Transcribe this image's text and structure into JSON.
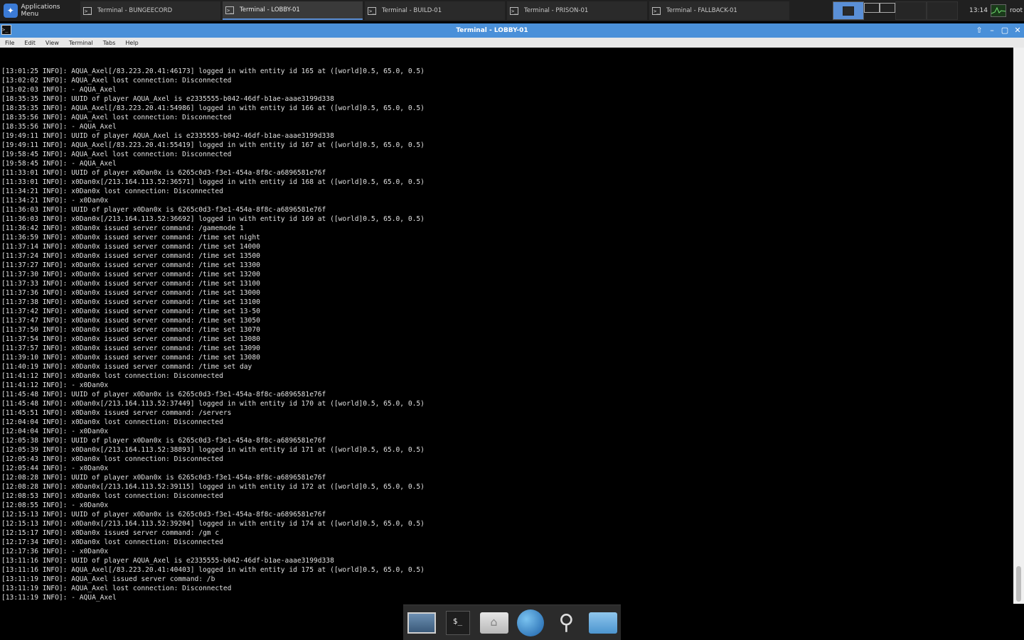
{
  "panel": {
    "apps_menu_label": "Applications Menu",
    "tasks": [
      {
        "label": "Terminal - BUNGEECORD",
        "active": false
      },
      {
        "label": "Terminal - LOBBY-01",
        "active": true
      },
      {
        "label": "Terminal - BUILD-01",
        "active": false
      },
      {
        "label": "Terminal - PRISON-01",
        "active": false
      },
      {
        "label": "Terminal - FALLBACK-01",
        "active": false
      }
    ],
    "clock": "13:14",
    "user": "root"
  },
  "window": {
    "title": "Terminal - LOBBY-01",
    "menu": [
      "File",
      "Edit",
      "View",
      "Terminal",
      "Tabs",
      "Help"
    ],
    "accent_color": "#4a90d9"
  },
  "terminal": {
    "lines": [
      "[13:01:25 INFO]: AQUA_Axel[/83.223.20.41:46173] logged in with entity id 165 at ([world]0.5, 65.0, 0.5)",
      "[13:02:02 INFO]: AQUA_Axel lost connection: Disconnected",
      "[13:02:03 INFO]: - AQUA_Axel",
      "[18:35:35 INFO]: UUID of player AQUA_Axel is e2335555-b042-46df-b1ae-aaae3199d338",
      "[18:35:35 INFO]: AQUA_Axel[/83.223.20.41:54986] logged in with entity id 166 at ([world]0.5, 65.0, 0.5)",
      "[18:35:56 INFO]: AQUA_Axel lost connection: Disconnected",
      "[18:35:56 INFO]: - AQUA_Axel",
      "[19:49:11 INFO]: UUID of player AQUA_Axel is e2335555-b042-46df-b1ae-aaae3199d338",
      "[19:49:11 INFO]: AQUA_Axel[/83.223.20.41:55419] logged in with entity id 167 at ([world]0.5, 65.0, 0.5)",
      "[19:58:45 INFO]: AQUA_Axel lost connection: Disconnected",
      "[19:58:45 INFO]: - AQUA_Axel",
      "[11:33:01 INFO]: UUID of player x0Dan0x is 6265c0d3-f3e1-454a-8f8c-a6896581e76f",
      "[11:33:01 INFO]: x0Dan0x[/213.164.113.52:36571] logged in with entity id 168 at ([world]0.5, 65.0, 0.5)",
      "[11:34:21 INFO]: x0Dan0x lost connection: Disconnected",
      "[11:34:21 INFO]: - x0Dan0x",
      "[11:36:03 INFO]: UUID of player x0Dan0x is 6265c0d3-f3e1-454a-8f8c-a6896581e76f",
      "[11:36:03 INFO]: x0Dan0x[/213.164.113.52:36692] logged in with entity id 169 at ([world]0.5, 65.0, 0.5)",
      "[11:36:42 INFO]: x0Dan0x issued server command: /gamemode 1",
      "[11:36:59 INFO]: x0Dan0x issued server command: /time set night",
      "[11:37:14 INFO]: x0Dan0x issued server command: /time set 14000",
      "[11:37:24 INFO]: x0Dan0x issued server command: /time set 13500",
      "[11:37:27 INFO]: x0Dan0x issued server command: /time set 13300",
      "[11:37:30 INFO]: x0Dan0x issued server command: /time set 13200",
      "[11:37:33 INFO]: x0Dan0x issued server command: /time set 13100",
      "[11:37:36 INFO]: x0Dan0x issued server command: /time set 13000",
      "[11:37:38 INFO]: x0Dan0x issued server command: /time set 13100",
      "[11:37:42 INFO]: x0Dan0x issued server command: /time set 13-50",
      "[11:37:47 INFO]: x0Dan0x issued server command: /time set 13050",
      "[11:37:50 INFO]: x0Dan0x issued server command: /time set 13070",
      "[11:37:54 INFO]: x0Dan0x issued server command: /time set 13080",
      "[11:37:57 INFO]: x0Dan0x issued server command: /time set 13090",
      "[11:39:10 INFO]: x0Dan0x issued server command: /time set 13080",
      "[11:40:19 INFO]: x0Dan0x issued server command: /time set day",
      "[11:41:12 INFO]: x0Dan0x lost connection: Disconnected",
      "[11:41:12 INFO]: - x0Dan0x",
      "[11:45:48 INFO]: UUID of player x0Dan0x is 6265c0d3-f3e1-454a-8f8c-a6896581e76f",
      "[11:45:48 INFO]: x0Dan0x[/213.164.113.52:37449] logged in with entity id 170 at ([world]0.5, 65.0, 0.5)",
      "[11:45:51 INFO]: x0Dan0x issued server command: /servers",
      "[12:04:04 INFO]: x0Dan0x lost connection: Disconnected",
      "[12:04:04 INFO]: - x0Dan0x",
      "[12:05:38 INFO]: UUID of player x0Dan0x is 6265c0d3-f3e1-454a-8f8c-a6896581e76f",
      "[12:05:39 INFO]: x0Dan0x[/213.164.113.52:38893] logged in with entity id 171 at ([world]0.5, 65.0, 0.5)",
      "[12:05:43 INFO]: x0Dan0x lost connection: Disconnected",
      "[12:05:44 INFO]: - x0Dan0x",
      "[12:08:28 INFO]: UUID of player x0Dan0x is 6265c0d3-f3e1-454a-8f8c-a6896581e76f",
      "[12:08:28 INFO]: x0Dan0x[/213.164.113.52:39115] logged in with entity id 172 at ([world]0.5, 65.0, 0.5)",
      "[12:08:53 INFO]: x0Dan0x lost connection: Disconnected",
      "[12:08:55 INFO]: - x0Dan0x",
      "[12:15:13 INFO]: UUID of player x0Dan0x is 6265c0d3-f3e1-454a-8f8c-a6896581e76f",
      "[12:15:13 INFO]: x0Dan0x[/213.164.113.52:39204] logged in with entity id 174 at ([world]0.5, 65.0, 0.5)",
      "[12:15:17 INFO]: x0Dan0x issued server command: /gm c",
      "[12:17:34 INFO]: x0Dan0x lost connection: Disconnected",
      "[12:17:36 INFO]: - x0Dan0x",
      "[13:11:16 INFO]: UUID of player AQUA_Axel is e2335555-b042-46df-b1ae-aaae3199d338",
      "[13:11:16 INFO]: AQUA_Axel[/83.223.20.41:40403] logged in with entity id 175 at ([world]0.5, 65.0, 0.5)",
      "[13:11:19 INFO]: AQUA_Axel issued server command: /b",
      "[13:11:19 INFO]: AQUA_Axel lost connection: Disconnected",
      "[13:11:19 INFO]: - AQUA_Axel"
    ],
    "prompt": ">"
  },
  "dock": {
    "items": [
      "show-desktop",
      "terminal",
      "home-folder",
      "web-browser",
      "app-finder",
      "file-manager"
    ],
    "terminal_glyph": "$_"
  }
}
